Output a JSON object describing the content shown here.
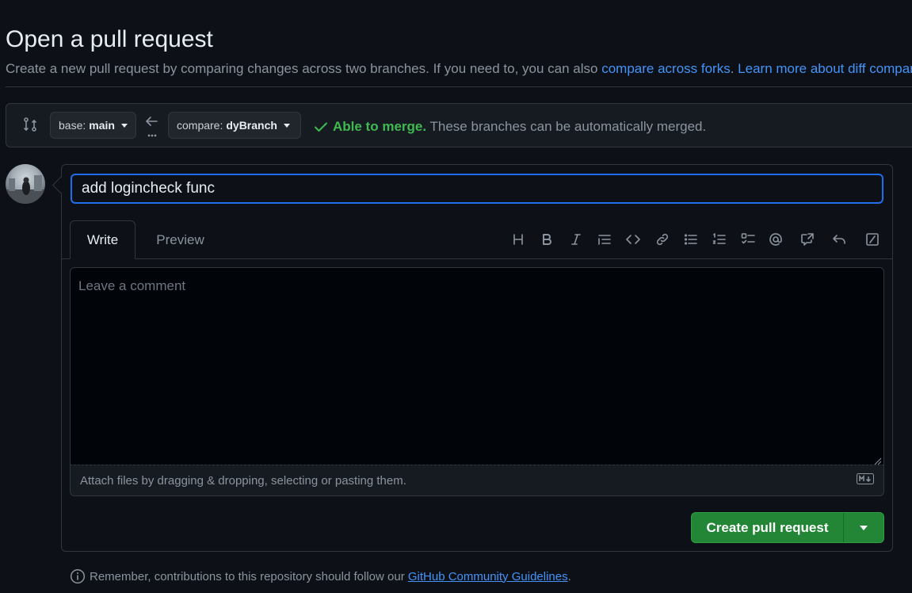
{
  "header": {
    "title": "Open a pull request",
    "subtitle_text": "Create a new pull request by comparing changes across two branches. If you need to, you can also ",
    "compare_forks_link": "compare across forks",
    "subtitle_sep": ". ",
    "learn_more_link": "Learn more about diff comparisons"
  },
  "range": {
    "base_label": "base: ",
    "base_branch": "main",
    "compare_label": "compare: ",
    "compare_branch": "dyBranch",
    "merge_ok": "Able to merge.",
    "merge_text": "These branches can be automatically merged."
  },
  "form": {
    "title_value": "add logincheck func",
    "tabs": {
      "write": "Write",
      "preview": "Preview"
    },
    "comment_placeholder": "Leave a comment",
    "attach_text": "Attach files by dragging & dropping, selecting or pasting them.",
    "toolbar_icons": [
      "heading-icon",
      "bold-icon",
      "italic-icon",
      "quote-icon",
      "code-icon",
      "link-icon",
      "unordered-list-icon",
      "ordered-list-icon",
      "task-list-icon",
      "mention-icon",
      "cross-reference-icon",
      "reply-icon",
      "slash-command-icon"
    ]
  },
  "actions": {
    "create_label": "Create pull request"
  },
  "footer": {
    "note_text": "Remember, contributions to this repository should follow our ",
    "guidelines_link": "GitHub Community Guidelines",
    "note_end": "."
  },
  "colors": {
    "background": "#0d1117",
    "accent_link": "#4493f8",
    "success": "#3fb950",
    "primary_button": "#238636",
    "focus_border": "#1f6feb"
  }
}
